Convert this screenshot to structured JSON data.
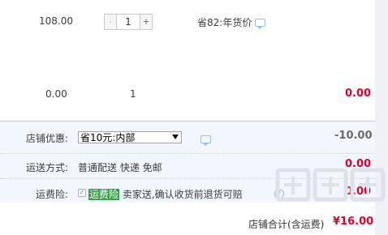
{
  "items": [
    {
      "price": "108.00",
      "quantity": "1",
      "minus": "-",
      "plus": "+",
      "discount": "省82:年货价"
    },
    {
      "price": "0.00",
      "quantity": "1",
      "subtotal": "0.00"
    }
  ],
  "shop_discount": {
    "label": "店铺优惠:",
    "selected": "省10元:内部",
    "amount": "-10.00"
  },
  "shipping": {
    "label": "运送方式:",
    "value": "普通配送 快递 免邮",
    "amount": "0.00"
  },
  "insurance": {
    "label": "运费险:",
    "badge": "运费险",
    "text": "卖家送,确认收货前退货可赔",
    "amount": "0.00"
  },
  "summary": {
    "label": "店铺合计(含运费)",
    "amount": "¥16.00"
  },
  "watermark": "值什么值得买",
  "colors": {
    "accent_red": "#e4002b",
    "panel_bg": "#f2f7ff",
    "badge_green": "#3aa14b"
  }
}
